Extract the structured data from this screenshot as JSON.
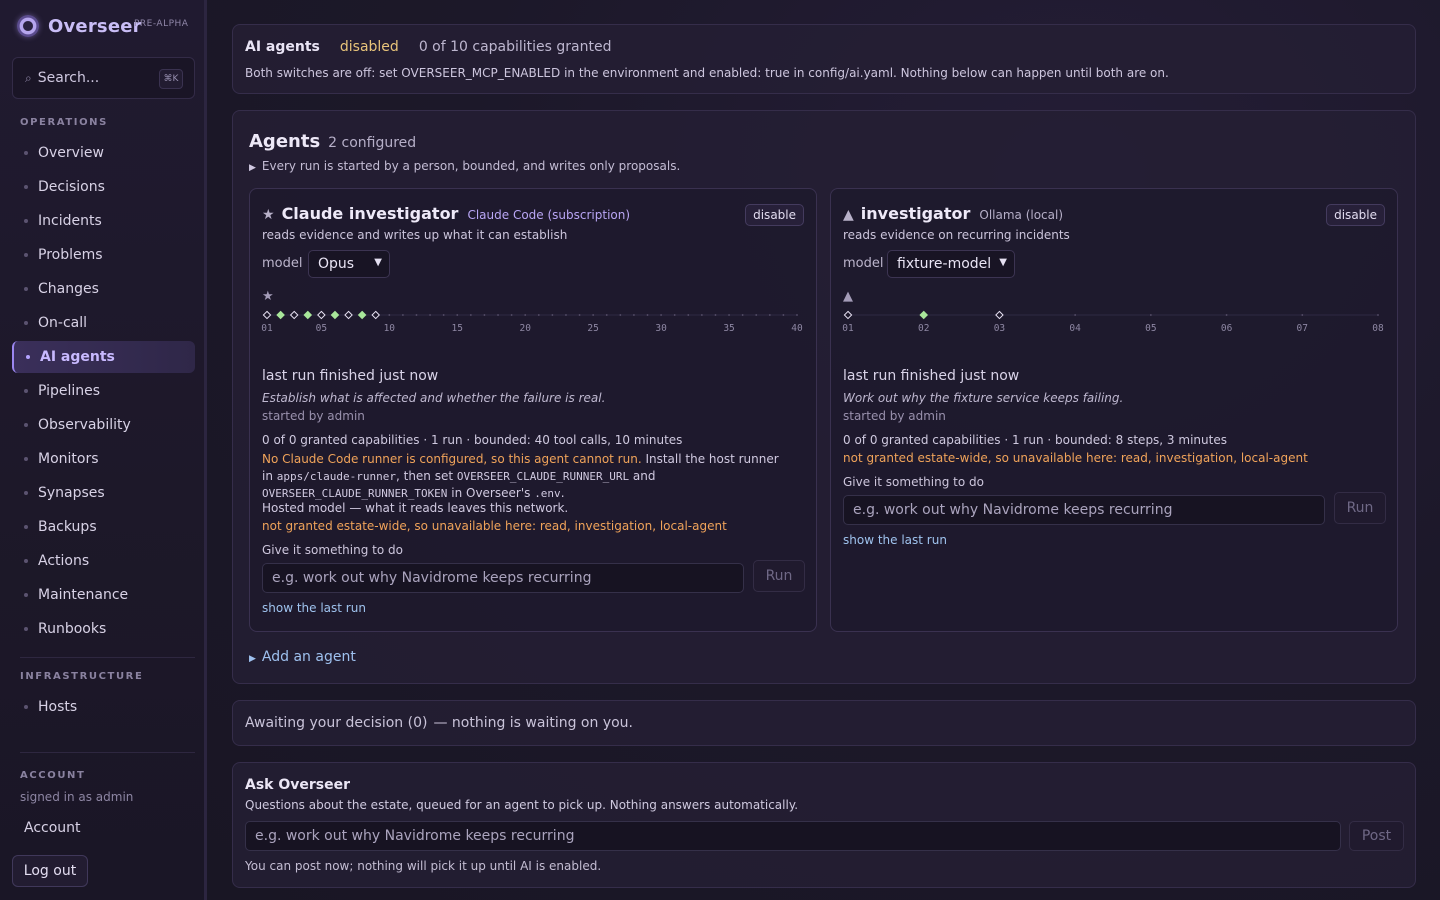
{
  "brand": {
    "name": "Overseer",
    "badge": "PRE-ALPHA"
  },
  "search": {
    "placeholder": "Search...",
    "shortcut": "⌘K"
  },
  "nav": {
    "operations_label": "OPERATIONS",
    "operations": [
      "Overview",
      "Decisions",
      "Incidents",
      "Problems",
      "Changes",
      "On-call",
      "AI agents",
      "Pipelines",
      "Observability",
      "Monitors",
      "Synapses",
      "Backups",
      "Actions",
      "Maintenance",
      "Runbooks"
    ],
    "active": "AI agents",
    "infrastructure_label": "INFRASTRUCTURE",
    "infrastructure": [
      "Hosts"
    ],
    "account_label": "ACCOUNT",
    "signed_in": "signed in as admin",
    "account": "Account",
    "logout": "Log out"
  },
  "status": {
    "title": "AI agents",
    "state": "disabled",
    "granted": "0 of 10 capabilities granted",
    "description": "Both switches are off: set OVERSEER_MCP_ENABLED in the environment and enabled: true in config/ai.yaml. Nothing below can happen until both are on."
  },
  "agents": {
    "title": "Agents",
    "count": "2 configured",
    "note": "Every run is started by a person, bounded, and writes only proposals.",
    "add_agent": "Add an agent",
    "cards": [
      {
        "icon": "star-icon",
        "glyph": "★",
        "name": "Claude investigator",
        "provider": "Claude Code (subscription)",
        "disable": "disable",
        "description": "reads evidence and writes up what it can establish",
        "model_label": "model",
        "model": "Opus",
        "last_run": "last run finished just now",
        "task": "Establish what is affected and whether the failure is real.",
        "started_by": "started by admin",
        "caps": "0 of 0 granted capabilities · 1 run · bounded: 40 tool calls, 10 minutes",
        "runner_warn": "No Claude Code runner is configured, so this agent cannot run.",
        "runner_t1": " Install the host runner in ",
        "runner_c1": "apps/claude-runner",
        "runner_t2": ", then set ",
        "runner_c2": "OVERSEER_CLAUDE_RUNNER_URL",
        "runner_t3": " and ",
        "runner_c3": "OVERSEER_CLAUDE_RUNNER_TOKEN",
        "runner_t4": " in Overseer's ",
        "runner_c4": ".env",
        "runner_t5": ".",
        "hosted": "Hosted model — what it reads leaves this network.",
        "not_granted": "not granted estate-wide, so unavailable here: read, investigation, local-agent",
        "give_label": "Give it something to do",
        "input_placeholder": "e.g. work out why Navidrome keeps recurring",
        "run": "Run",
        "show_last": "show the last run",
        "timeline": {
          "slots": 40,
          "run_states": [
            "open",
            "filled",
            "open",
            "filled",
            "open",
            "filled",
            "open",
            "filled",
            "open"
          ],
          "tick_labels": [
            "01",
            "05",
            "10",
            "15",
            "20",
            "25",
            "30",
            "35",
            "40"
          ],
          "tick_slots": [
            1,
            5,
            10,
            15,
            20,
            25,
            30,
            35,
            40
          ]
        }
      },
      {
        "icon": "triangle-icon",
        "glyph": "▲",
        "name": "investigator",
        "provider": "Ollama (local)",
        "disable": "disable",
        "description": "reads evidence on recurring incidents",
        "model_label": "model",
        "model": "fixture-model",
        "last_run": "last run finished just now",
        "task": "Work out why the fixture service keeps failing.",
        "started_by": "started by admin",
        "caps": "0 of 0 granted capabilities · 1 run · bounded: 8 steps, 3 minutes",
        "not_granted": "not granted estate-wide, so unavailable here: read, investigation, local-agent",
        "give_label": "Give it something to do",
        "input_placeholder": "e.g. work out why Navidrome keeps recurring",
        "run": "Run",
        "show_last": "show the last run",
        "timeline": {
          "slots": 8,
          "run_states": [
            "open",
            "filled",
            "open"
          ],
          "tick_labels": [
            "01",
            "02",
            "03",
            "04",
            "05",
            "06",
            "07",
            "08"
          ],
          "tick_slots": [
            1,
            2,
            3,
            4,
            5,
            6,
            7,
            8
          ]
        }
      }
    ]
  },
  "awaiting": {
    "label": "Awaiting your decision (0)",
    "note": "— nothing is waiting on you."
  },
  "ask": {
    "title": "Ask Overseer",
    "subtitle": "Questions about the estate, queued for an agent to pick up. Nothing answers automatically.",
    "placeholder": "e.g. work out why Navidrome keeps recurring",
    "post": "Post",
    "footer": "You can post now; nothing will pick it up until AI is enabled."
  },
  "colors": {
    "accent": "#b4a3ff",
    "warning": "#f0a35a",
    "disabled_state": "#e8c47a",
    "link": "#9fc3ee",
    "diamond_filled": "#a8e69a"
  }
}
